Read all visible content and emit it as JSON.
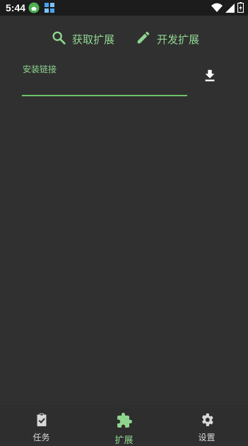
{
  "status_bar": {
    "time": "5:44",
    "icons": [
      "app-notification-icon",
      "app-grid-icon",
      "wifi-icon",
      "signal-icon",
      "battery-icon"
    ]
  },
  "top_actions": {
    "get_extension_label": "获取扩展",
    "develop_extension_label": "开发扩展"
  },
  "install": {
    "label": "安装链接",
    "value": "",
    "placeholder": ""
  },
  "bottom_nav": {
    "items": [
      {
        "label": "任务",
        "icon": "task-clipboard-icon",
        "active": false
      },
      {
        "label": "扩展",
        "icon": "puzzle-icon",
        "active": true
      },
      {
        "label": "设置",
        "icon": "gear-icon",
        "active": false
      }
    ]
  },
  "colors": {
    "accent": "#8fd48f",
    "background": "#303030",
    "status_bar": "#1c1c1c"
  }
}
